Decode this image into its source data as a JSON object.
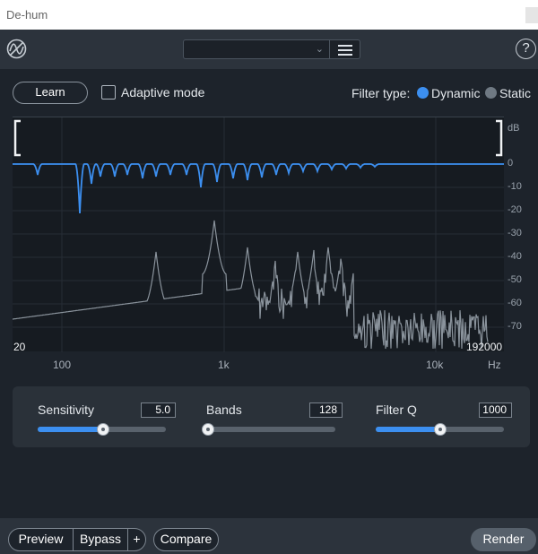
{
  "window": {
    "title": "De-hum"
  },
  "header": {
    "preset_value": "",
    "help_label": "?"
  },
  "controls": {
    "learn_label": "Learn",
    "adaptive_label": "Adaptive mode",
    "adaptive_checked": false,
    "filter_type_label": "Filter type:",
    "filter_types": [
      "Dynamic",
      "Static"
    ],
    "filter_type_selected": "Dynamic"
  },
  "graph": {
    "db_unit": "dB",
    "db_ticks": [
      "0",
      "-10",
      "-20",
      "-30",
      "-40",
      "-50",
      "-60",
      "-70"
    ],
    "range_low": "20",
    "range_high": "192000",
    "freq_ticks": [
      "100",
      "1k",
      "10k"
    ],
    "freq_unit": "Hz"
  },
  "params": {
    "sensitivity": {
      "label": "Sensitivity",
      "value": "5.0",
      "fraction": 0.51
    },
    "bands": {
      "label": "Bands",
      "value": "128",
      "fraction": 0.0
    },
    "filter_q": {
      "label": "Filter Q",
      "value": "1000",
      "fraction": 0.5
    }
  },
  "footer": {
    "preview_label": "Preview",
    "bypass_label": "Bypass",
    "plus_label": "+",
    "compare_label": "Compare",
    "render_label": "Render"
  },
  "colors": {
    "accent": "#3c8ff0",
    "background": "#1d232b",
    "panel": "#2c333c"
  }
}
